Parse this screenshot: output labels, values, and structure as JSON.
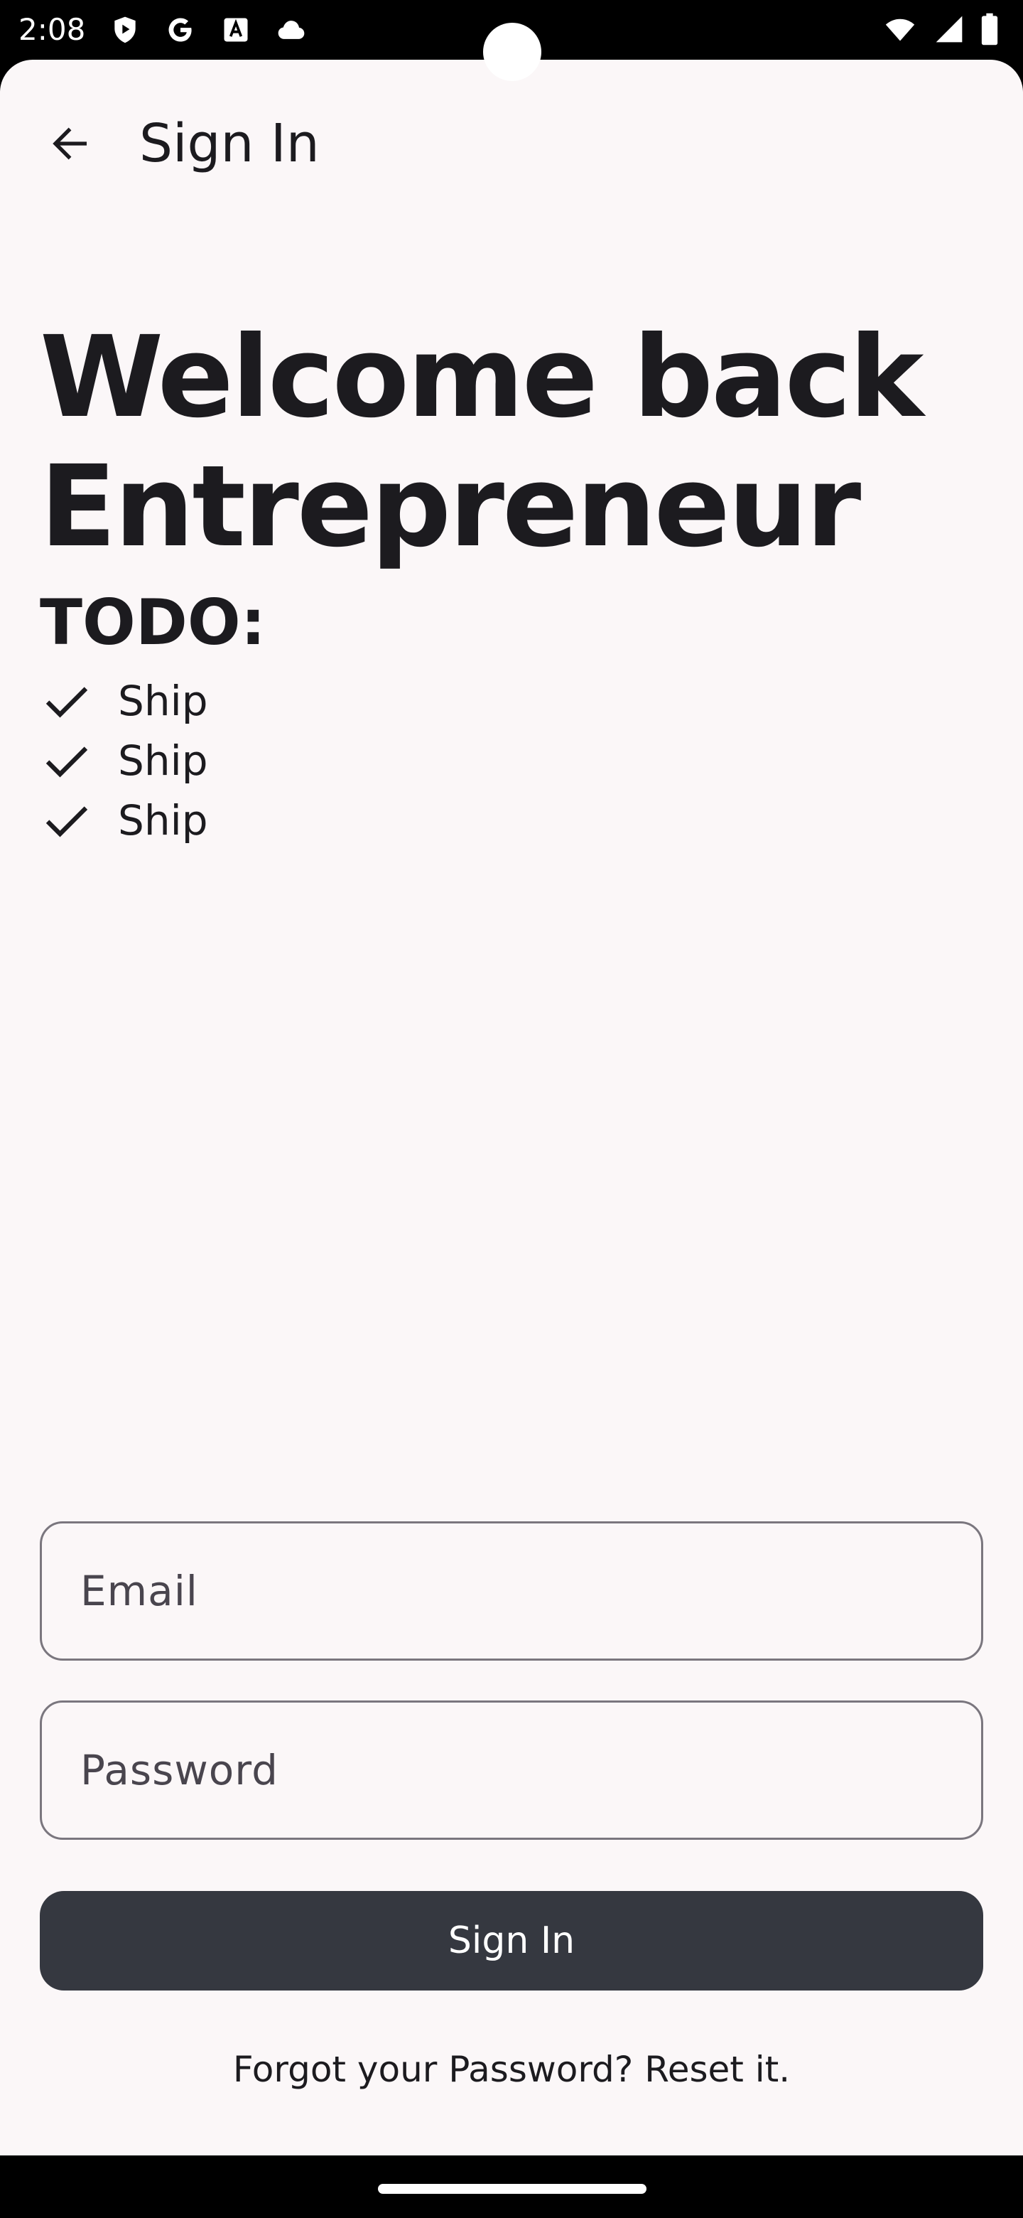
{
  "status_bar": {
    "time": "2:08",
    "left_icons": [
      "shield-play-icon",
      "google-icon",
      "font-a-icon",
      "cloud-icon"
    ],
    "right_icons": [
      "wifi-icon",
      "cellular-signal-icon",
      "battery-icon"
    ]
  },
  "app_bar": {
    "back_icon": "arrow-back-icon",
    "title": "Sign In"
  },
  "hero": {
    "title_line1": "Welcome back",
    "title_line2": "Entrepreneur",
    "todo_heading": "TODO:",
    "todo_items": [
      {
        "icon": "check-icon",
        "label": "Ship"
      },
      {
        "icon": "check-icon",
        "label": "Ship"
      },
      {
        "icon": "check-icon",
        "label": "Ship"
      }
    ]
  },
  "form": {
    "email": {
      "placeholder": "Email",
      "value": ""
    },
    "password": {
      "placeholder": "Password",
      "value": ""
    },
    "submit_label": "Sign In",
    "forgot_text": "Forgot your Password? Reset it."
  },
  "colors": {
    "background": "#fbf7f8",
    "text": "#1c1b1f",
    "button": "#353840",
    "outline": "#7a767e",
    "system_bar": "#000000"
  }
}
